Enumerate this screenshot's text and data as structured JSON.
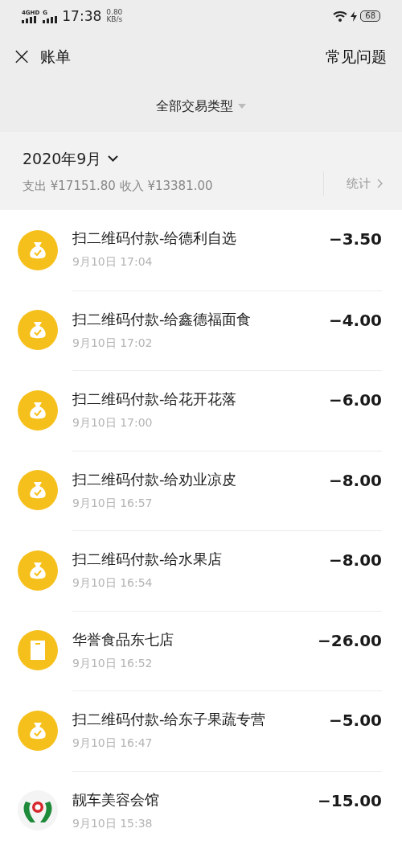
{
  "status_bar": {
    "network": "4GHD",
    "network2": "G",
    "time": "17:38",
    "speed": "0.80",
    "speed_unit": "KB/s",
    "battery": "68"
  },
  "header": {
    "close": "×",
    "title": "账单",
    "help": "常见问题"
  },
  "filter": {
    "label": "全部交易类型"
  },
  "month": {
    "label": "2020年9月",
    "summary": "支出 ¥17151.80 收入 ¥13381.00",
    "stats": "统计"
  },
  "transactions": [
    {
      "kind": "bag",
      "title": "扫二维码付款-给德利自选",
      "time": "9月10日 17:04",
      "amount": "−3.50"
    },
    {
      "kind": "bag",
      "title": "扫二维码付款-给鑫德福面食",
      "time": "9月10日 17:02",
      "amount": "−4.00"
    },
    {
      "kind": "bag",
      "title": "扫二维码付款-给花开花落",
      "time": "9月10日 17:00",
      "amount": "−6.00"
    },
    {
      "kind": "bag",
      "title": "扫二维码付款-给劝业凉皮",
      "time": "9月10日 16:57",
      "amount": "−8.00"
    },
    {
      "kind": "bag",
      "title": "扫二维码付款-给水果店",
      "time": "9月10日 16:54",
      "amount": "−8.00"
    },
    {
      "kind": "store",
      "title": "华誉食品东七店",
      "time": "9月10日 16:52",
      "amount": "−26.00"
    },
    {
      "kind": "bag",
      "title": "扫二维码付款-给东子果蔬专营",
      "time": "9月10日 16:47",
      "amount": "−5.00"
    },
    {
      "kind": "logo",
      "title": "靓车美容会馆",
      "time": "9月10日 15:38",
      "amount": "−15.00"
    }
  ]
}
